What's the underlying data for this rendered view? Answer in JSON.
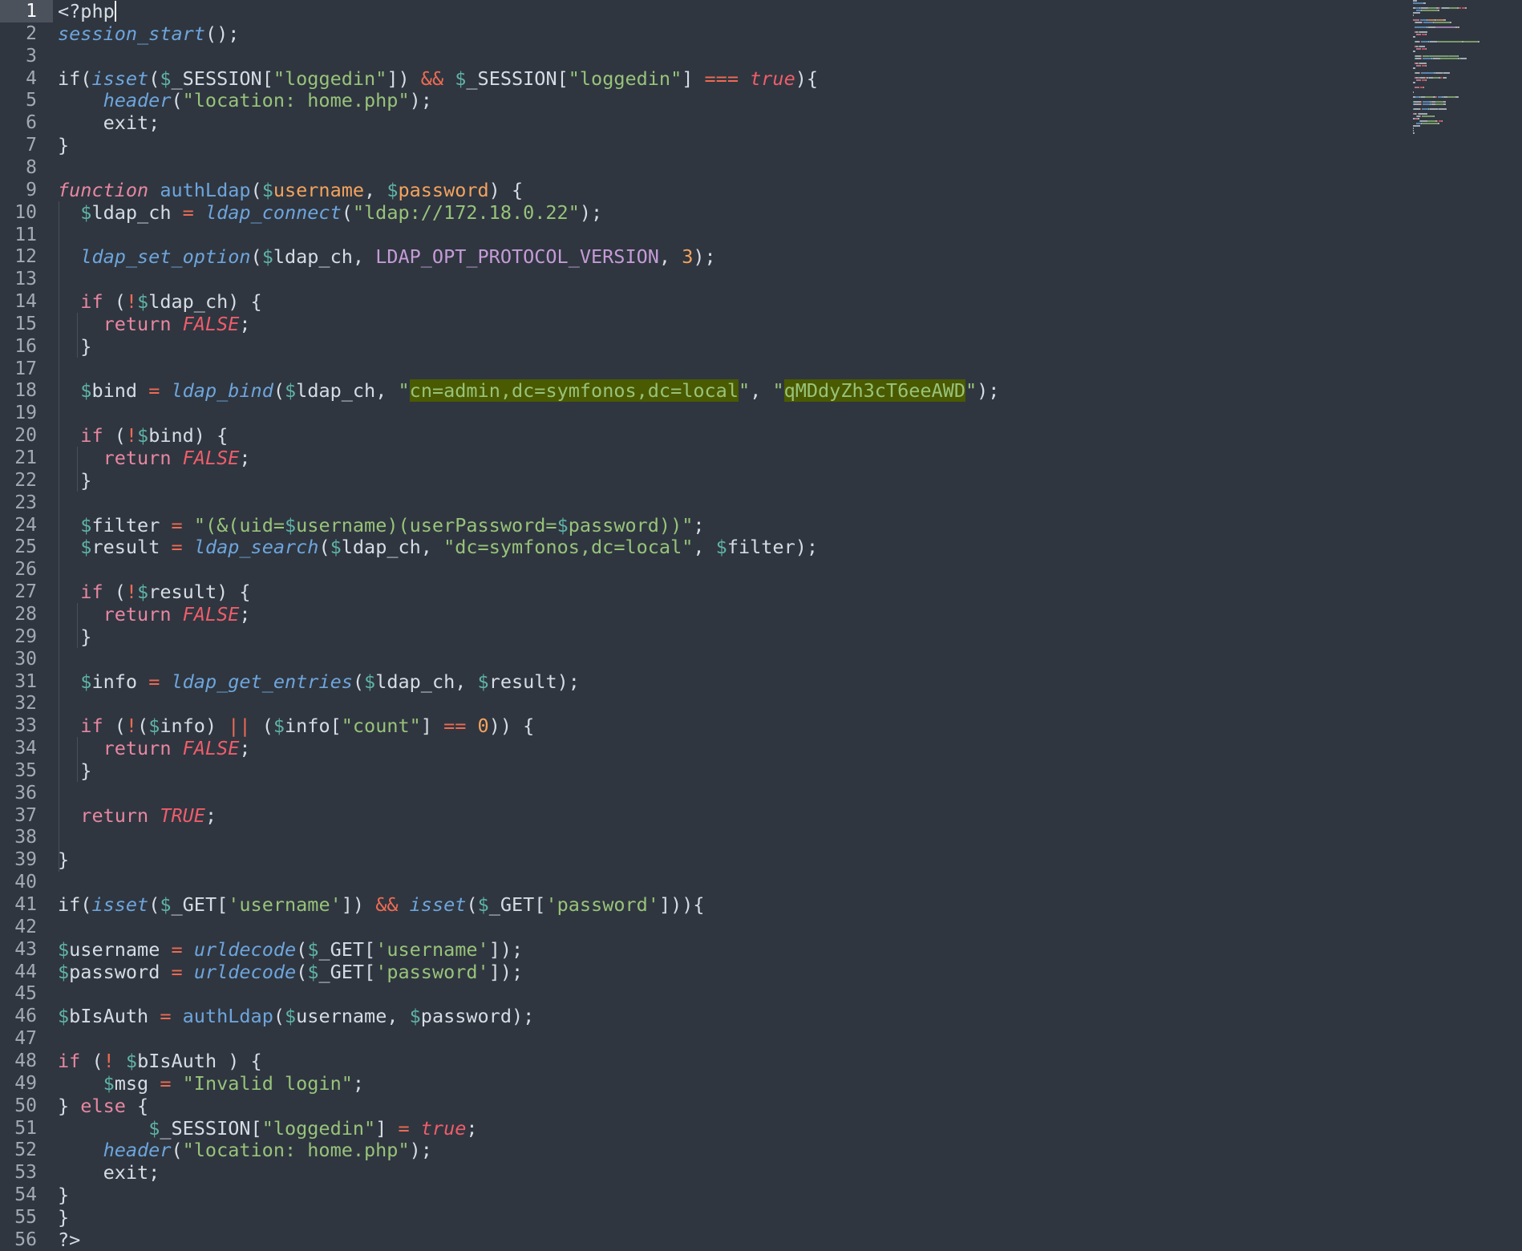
{
  "editor": {
    "language": "php",
    "active_line": 1,
    "colors": {
      "background": "#2f3640",
      "gutter_active": "#4b525b",
      "default": "#d6dce3",
      "function": "#6ea5dc",
      "variable": "#5fb3a6",
      "string": "#98c379",
      "operator": "#ef6b52",
      "boolean": "#ef5d6a",
      "keyword": "#e887a0",
      "number": "#f5a35d",
      "constant": "#c59bd6",
      "search_highlight": "#4a5a00"
    }
  },
  "lines": [
    {
      "n": "1",
      "tokens": [
        [
          "<?php",
          "default"
        ]
      ],
      "cursor": true
    },
    {
      "n": "2",
      "tokens": [
        [
          "session_start",
          "func-italic"
        ],
        [
          "();",
          "default"
        ]
      ]
    },
    {
      "n": "3",
      "tokens": []
    },
    {
      "n": "4",
      "tokens": [
        [
          "if(",
          "default"
        ],
        [
          "isset",
          "func-italic"
        ],
        [
          "(",
          "default"
        ],
        [
          "$",
          "var-dollar"
        ],
        [
          "_SESSION[",
          "default"
        ],
        [
          "\"loggedin\"",
          "string"
        ],
        [
          "]) ",
          "default"
        ],
        [
          "&&",
          "operator"
        ],
        [
          " ",
          "default"
        ],
        [
          "$",
          "var-dollar"
        ],
        [
          "_SESSION[",
          "default"
        ],
        [
          "\"loggedin\"",
          "string"
        ],
        [
          "] ",
          "default"
        ],
        [
          "===",
          "operator"
        ],
        [
          " ",
          "default"
        ],
        [
          "true",
          "bool"
        ],
        [
          "){",
          "default"
        ]
      ]
    },
    {
      "n": "5",
      "tokens": [
        [
          "    ",
          "default"
        ],
        [
          "header",
          "func-italic"
        ],
        [
          "(",
          "default"
        ],
        [
          "\"location: home.php\"",
          "string"
        ],
        [
          ");",
          "default"
        ]
      ]
    },
    {
      "n": "6",
      "tokens": [
        [
          "    exit;",
          "default"
        ]
      ]
    },
    {
      "n": "7",
      "tokens": [
        [
          "}",
          "default"
        ]
      ]
    },
    {
      "n": "8",
      "tokens": []
    },
    {
      "n": "9",
      "tokens": [
        [
          "function",
          "keyword-italic"
        ],
        [
          " ",
          "default"
        ],
        [
          "authLdap",
          "func"
        ],
        [
          "(",
          "default"
        ],
        [
          "$",
          "var-dollar"
        ],
        [
          "username",
          "param"
        ],
        [
          ", ",
          "default"
        ],
        [
          "$",
          "var-dollar"
        ],
        [
          "password",
          "param"
        ],
        [
          ") {",
          "default"
        ]
      ]
    },
    {
      "n": "10",
      "tokens": [
        [
          "  ",
          "default"
        ],
        [
          "$",
          "var-dollar"
        ],
        [
          "ldap_ch ",
          "default"
        ],
        [
          "=",
          "operator"
        ],
        [
          " ",
          "default"
        ],
        [
          "ldap_connect",
          "func-italic"
        ],
        [
          "(",
          "default"
        ],
        [
          "\"ldap://172.18.0.22\"",
          "string"
        ],
        [
          ");",
          "default"
        ]
      ]
    },
    {
      "n": "11",
      "tokens": []
    },
    {
      "n": "12",
      "tokens": [
        [
          "  ",
          "default"
        ],
        [
          "ldap_set_option",
          "func-italic"
        ],
        [
          "(",
          "default"
        ],
        [
          "$",
          "var-dollar"
        ],
        [
          "ldap_ch, ",
          "default"
        ],
        [
          "LDAP_OPT_PROTOCOL_VERSION",
          "const"
        ],
        [
          ", ",
          "default"
        ],
        [
          "3",
          "number"
        ],
        [
          ");",
          "default"
        ]
      ]
    },
    {
      "n": "13",
      "tokens": []
    },
    {
      "n": "14",
      "tokens": [
        [
          "  ",
          "default"
        ],
        [
          "if",
          "keyword"
        ],
        [
          " (",
          "default"
        ],
        [
          "!",
          "operator"
        ],
        [
          "$",
          "var-dollar"
        ],
        [
          "ldap_ch) {",
          "default"
        ]
      ]
    },
    {
      "n": "15",
      "tokens": [
        [
          "    ",
          "default"
        ],
        [
          "return",
          "keyword"
        ],
        [
          " ",
          "default"
        ],
        [
          "FALSE",
          "bool"
        ],
        [
          ";",
          "default"
        ]
      ]
    },
    {
      "n": "16",
      "tokens": [
        [
          "  }",
          "default"
        ]
      ]
    },
    {
      "n": "17",
      "tokens": []
    },
    {
      "n": "18",
      "tokens": [
        [
          "  ",
          "default"
        ],
        [
          "$",
          "var-dollar"
        ],
        [
          "bind ",
          "default"
        ],
        [
          "=",
          "operator"
        ],
        [
          " ",
          "default"
        ],
        [
          "ldap_bind",
          "func-italic"
        ],
        [
          "(",
          "default"
        ],
        [
          "$",
          "var-dollar"
        ],
        [
          "ldap_ch, ",
          "default"
        ],
        [
          "\"",
          "string"
        ],
        [
          "cn=admin,dc=symfonos,dc=local",
          "highlight"
        ],
        [
          "\"",
          "string"
        ],
        [
          ", ",
          "default"
        ],
        [
          "\"",
          "string"
        ],
        [
          "qMDdyZh3cT6eeAWD",
          "highlight"
        ],
        [
          "\"",
          "string"
        ],
        [
          ");",
          "default"
        ]
      ]
    },
    {
      "n": "19",
      "tokens": []
    },
    {
      "n": "20",
      "tokens": [
        [
          "  ",
          "default"
        ],
        [
          "if",
          "keyword"
        ],
        [
          " (",
          "default"
        ],
        [
          "!",
          "operator"
        ],
        [
          "$",
          "var-dollar"
        ],
        [
          "bind) {",
          "default"
        ]
      ]
    },
    {
      "n": "21",
      "tokens": [
        [
          "    ",
          "default"
        ],
        [
          "return",
          "keyword"
        ],
        [
          " ",
          "default"
        ],
        [
          "FALSE",
          "bool"
        ],
        [
          ";",
          "default"
        ]
      ]
    },
    {
      "n": "22",
      "tokens": [
        [
          "  }",
          "default"
        ]
      ]
    },
    {
      "n": "23",
      "tokens": []
    },
    {
      "n": "24",
      "tokens": [
        [
          "  ",
          "default"
        ],
        [
          "$",
          "var-dollar"
        ],
        [
          "filter ",
          "default"
        ],
        [
          "=",
          "operator"
        ],
        [
          " ",
          "default"
        ],
        [
          "\"(&(uid=",
          "string"
        ],
        [
          "$",
          "var-dollar"
        ],
        [
          "username)(userPassword=",
          "string"
        ],
        [
          "$",
          "var-dollar"
        ],
        [
          "password))\"",
          "string"
        ],
        [
          ";",
          "default"
        ]
      ]
    },
    {
      "n": "25",
      "tokens": [
        [
          "  ",
          "default"
        ],
        [
          "$",
          "var-dollar"
        ],
        [
          "result ",
          "default"
        ],
        [
          "=",
          "operator"
        ],
        [
          " ",
          "default"
        ],
        [
          "ldap_search",
          "func-italic"
        ],
        [
          "(",
          "default"
        ],
        [
          "$",
          "var-dollar"
        ],
        [
          "ldap_ch, ",
          "default"
        ],
        [
          "\"dc=symfonos,dc=local\"",
          "string"
        ],
        [
          ", ",
          "default"
        ],
        [
          "$",
          "var-dollar"
        ],
        [
          "filter);",
          "default"
        ]
      ]
    },
    {
      "n": "26",
      "tokens": []
    },
    {
      "n": "27",
      "tokens": [
        [
          "  ",
          "default"
        ],
        [
          "if",
          "keyword"
        ],
        [
          " (",
          "default"
        ],
        [
          "!",
          "operator"
        ],
        [
          "$",
          "var-dollar"
        ],
        [
          "result) {",
          "default"
        ]
      ]
    },
    {
      "n": "28",
      "tokens": [
        [
          "    ",
          "default"
        ],
        [
          "return",
          "keyword"
        ],
        [
          " ",
          "default"
        ],
        [
          "FALSE",
          "bool"
        ],
        [
          ";",
          "default"
        ]
      ]
    },
    {
      "n": "29",
      "tokens": [
        [
          "  }",
          "default"
        ]
      ]
    },
    {
      "n": "30",
      "tokens": []
    },
    {
      "n": "31",
      "tokens": [
        [
          "  ",
          "default"
        ],
        [
          "$",
          "var-dollar"
        ],
        [
          "info ",
          "default"
        ],
        [
          "=",
          "operator"
        ],
        [
          " ",
          "default"
        ],
        [
          "ldap_get_entries",
          "func-italic"
        ],
        [
          "(",
          "default"
        ],
        [
          "$",
          "var-dollar"
        ],
        [
          "ldap_ch, ",
          "default"
        ],
        [
          "$",
          "var-dollar"
        ],
        [
          "result);",
          "default"
        ]
      ]
    },
    {
      "n": "32",
      "tokens": []
    },
    {
      "n": "33",
      "tokens": [
        [
          "  ",
          "default"
        ],
        [
          "if",
          "keyword"
        ],
        [
          " (",
          "default"
        ],
        [
          "!",
          "operator"
        ],
        [
          "(",
          "default"
        ],
        [
          "$",
          "var-dollar"
        ],
        [
          "info) ",
          "default"
        ],
        [
          "||",
          "operator"
        ],
        [
          " (",
          "default"
        ],
        [
          "$",
          "var-dollar"
        ],
        [
          "info[",
          "default"
        ],
        [
          "\"count\"",
          "string"
        ],
        [
          "] ",
          "default"
        ],
        [
          "==",
          "operator"
        ],
        [
          " ",
          "default"
        ],
        [
          "0",
          "number"
        ],
        [
          ")) {",
          "default"
        ]
      ]
    },
    {
      "n": "34",
      "tokens": [
        [
          "    ",
          "default"
        ],
        [
          "return",
          "keyword"
        ],
        [
          " ",
          "default"
        ],
        [
          "FALSE",
          "bool"
        ],
        [
          ";",
          "default"
        ]
      ]
    },
    {
      "n": "35",
      "tokens": [
        [
          "  }",
          "default"
        ]
      ]
    },
    {
      "n": "36",
      "tokens": []
    },
    {
      "n": "37",
      "tokens": [
        [
          "  ",
          "default"
        ],
        [
          "return",
          "keyword"
        ],
        [
          " ",
          "default"
        ],
        [
          "TRUE",
          "bool"
        ],
        [
          ";",
          "default"
        ]
      ]
    },
    {
      "n": "38",
      "tokens": []
    },
    {
      "n": "39",
      "tokens": [
        [
          "}",
          "default"
        ]
      ]
    },
    {
      "n": "40",
      "tokens": []
    },
    {
      "n": "41",
      "tokens": [
        [
          "if(",
          "default"
        ],
        [
          "isset",
          "func-italic"
        ],
        [
          "(",
          "default"
        ],
        [
          "$",
          "var-dollar"
        ],
        [
          "_GET[",
          "default"
        ],
        [
          "'username'",
          "string"
        ],
        [
          "]) ",
          "default"
        ],
        [
          "&&",
          "operator"
        ],
        [
          " ",
          "default"
        ],
        [
          "isset",
          "func-italic"
        ],
        [
          "(",
          "default"
        ],
        [
          "$",
          "var-dollar"
        ],
        [
          "_GET[",
          "default"
        ],
        [
          "'password'",
          "string"
        ],
        [
          "])){",
          "default"
        ]
      ]
    },
    {
      "n": "42",
      "tokens": []
    },
    {
      "n": "43",
      "tokens": [
        [
          "$",
          "var-dollar"
        ],
        [
          "username ",
          "default"
        ],
        [
          "=",
          "operator"
        ],
        [
          " ",
          "default"
        ],
        [
          "urldecode",
          "func-italic"
        ],
        [
          "(",
          "default"
        ],
        [
          "$",
          "var-dollar"
        ],
        [
          "_GET[",
          "default"
        ],
        [
          "'username'",
          "string"
        ],
        [
          "]);",
          "default"
        ]
      ]
    },
    {
      "n": "44",
      "tokens": [
        [
          "$",
          "var-dollar"
        ],
        [
          "password ",
          "default"
        ],
        [
          "=",
          "operator"
        ],
        [
          " ",
          "default"
        ],
        [
          "urldecode",
          "func-italic"
        ],
        [
          "(",
          "default"
        ],
        [
          "$",
          "var-dollar"
        ],
        [
          "_GET[",
          "default"
        ],
        [
          "'password'",
          "string"
        ],
        [
          "]);",
          "default"
        ]
      ]
    },
    {
      "n": "45",
      "tokens": []
    },
    {
      "n": "46",
      "tokens": [
        [
          "$",
          "var-dollar"
        ],
        [
          "bIsAuth ",
          "default"
        ],
        [
          "=",
          "operator"
        ],
        [
          " ",
          "default"
        ],
        [
          "authLdap",
          "func"
        ],
        [
          "(",
          "default"
        ],
        [
          "$",
          "var-dollar"
        ],
        [
          "username, ",
          "default"
        ],
        [
          "$",
          "var-dollar"
        ],
        [
          "password);",
          "default"
        ]
      ]
    },
    {
      "n": "47",
      "tokens": []
    },
    {
      "n": "48",
      "tokens": [
        [
          "if",
          "keyword"
        ],
        [
          " (",
          "default"
        ],
        [
          "!",
          "operator"
        ],
        [
          " ",
          "default"
        ],
        [
          "$",
          "var-dollar"
        ],
        [
          "bIsAuth ) {",
          "default"
        ]
      ]
    },
    {
      "n": "49",
      "tokens": [
        [
          "    ",
          "default"
        ],
        [
          "$",
          "var-dollar"
        ],
        [
          "msg ",
          "default"
        ],
        [
          "=",
          "operator"
        ],
        [
          " ",
          "default"
        ],
        [
          "\"Invalid login\"",
          "string"
        ],
        [
          ";",
          "default"
        ]
      ]
    },
    {
      "n": "50",
      "tokens": [
        [
          "} ",
          "default"
        ],
        [
          "else",
          "keyword"
        ],
        [
          " {",
          "default"
        ]
      ]
    },
    {
      "n": "51",
      "tokens": [
        [
          "        ",
          "default"
        ],
        [
          "$",
          "var-dollar"
        ],
        [
          "_SESSION[",
          "default"
        ],
        [
          "\"loggedin\"",
          "string"
        ],
        [
          "] ",
          "default"
        ],
        [
          "=",
          "operator"
        ],
        [
          " ",
          "default"
        ],
        [
          "true",
          "bool"
        ],
        [
          ";",
          "default"
        ]
      ]
    },
    {
      "n": "52",
      "tokens": [
        [
          "    ",
          "default"
        ],
        [
          "header",
          "func-italic"
        ],
        [
          "(",
          "default"
        ],
        [
          "\"location: home.php\"",
          "string"
        ],
        [
          ");",
          "default"
        ]
      ]
    },
    {
      "n": "53",
      "tokens": [
        [
          "    exit;",
          "default"
        ]
      ]
    },
    {
      "n": "54",
      "tokens": [
        [
          "}",
          "default"
        ]
      ]
    },
    {
      "n": "55",
      "tokens": [
        [
          "}",
          "default"
        ]
      ]
    },
    {
      "n": "56",
      "tokens": [
        [
          "?>",
          "default"
        ]
      ]
    }
  ]
}
